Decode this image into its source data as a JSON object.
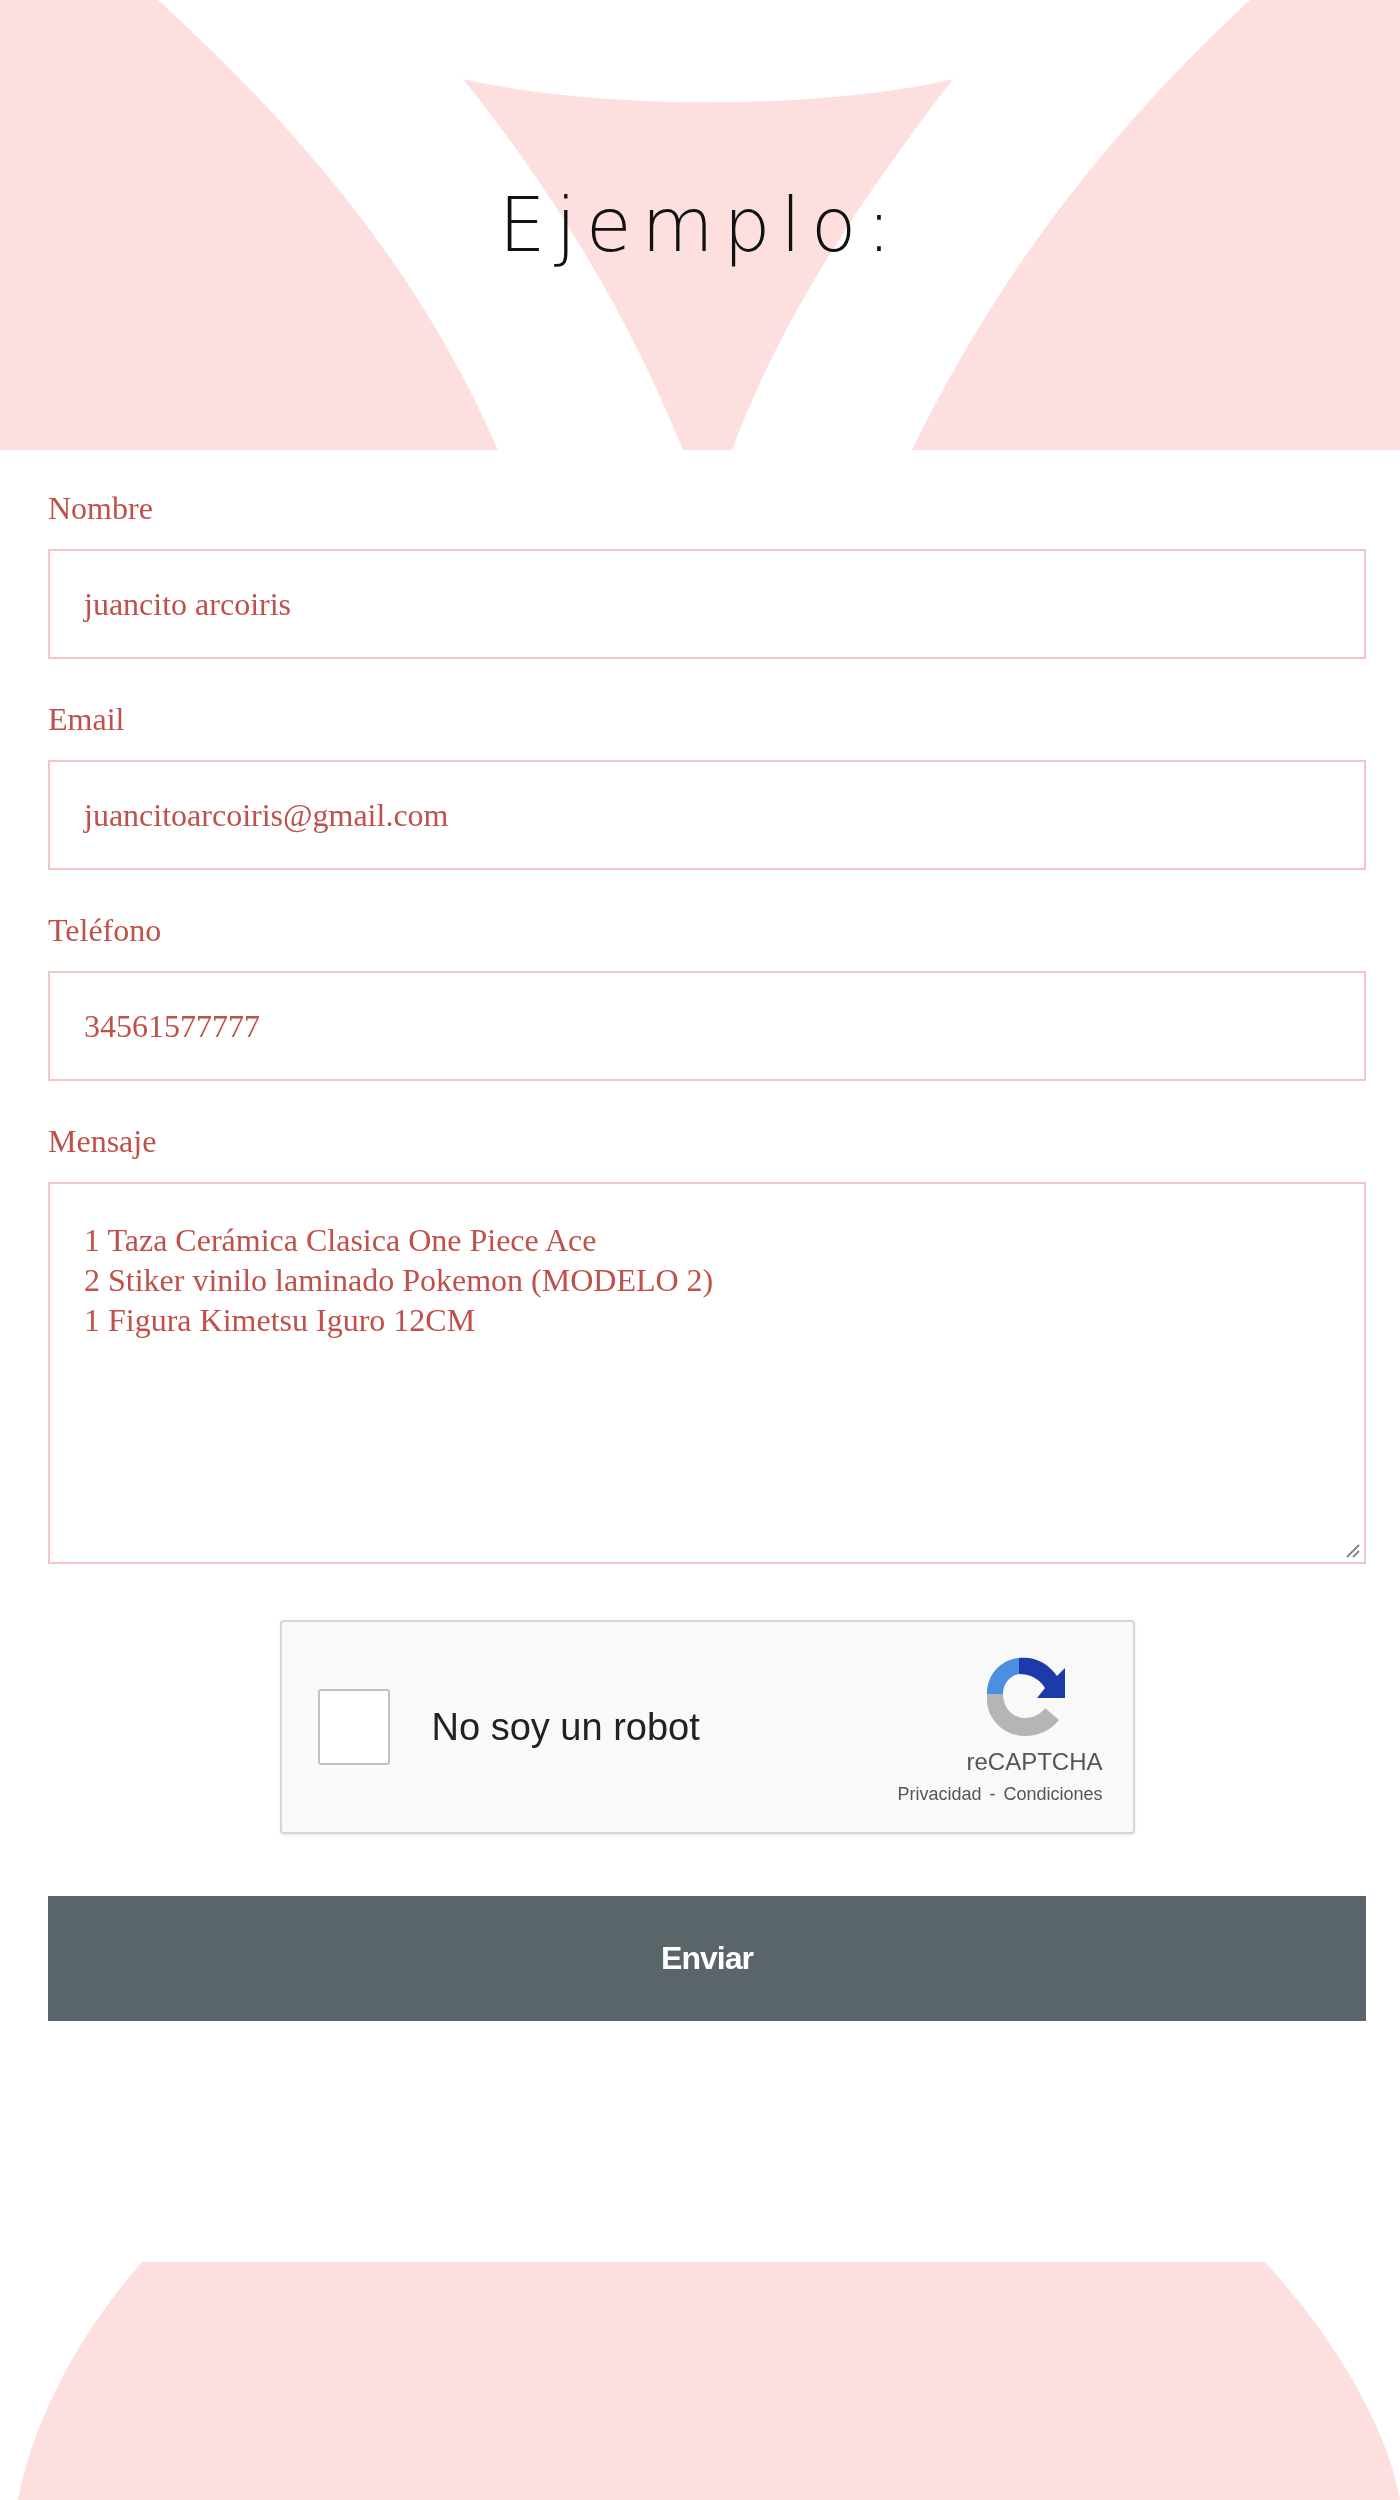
{
  "header": {
    "title": "Ejemplo:"
  },
  "form": {
    "fields": [
      {
        "kind": "input",
        "label": "Nombre",
        "value": "juancito arcoiris"
      },
      {
        "kind": "input",
        "label": "Email",
        "value": "juancitoarcoiris@gmail.com"
      },
      {
        "kind": "input",
        "label": "Teléfono",
        "value": "34561577777"
      },
      {
        "kind": "textarea",
        "label": "Mensaje",
        "value": "1 Taza Cerámica Clasica One Piece Ace\n2 Stiker vinilo laminado Pokemon (MODELO 2)\n1 Figura Kimetsu Iguro 12CM"
      }
    ],
    "captcha": {
      "checked": false,
      "label": "No soy un robot",
      "brand": "reCAPTCHA",
      "privacy": "Privacidad",
      "separator": "-",
      "terms": "Condiciones"
    },
    "submit": "Enviar"
  }
}
